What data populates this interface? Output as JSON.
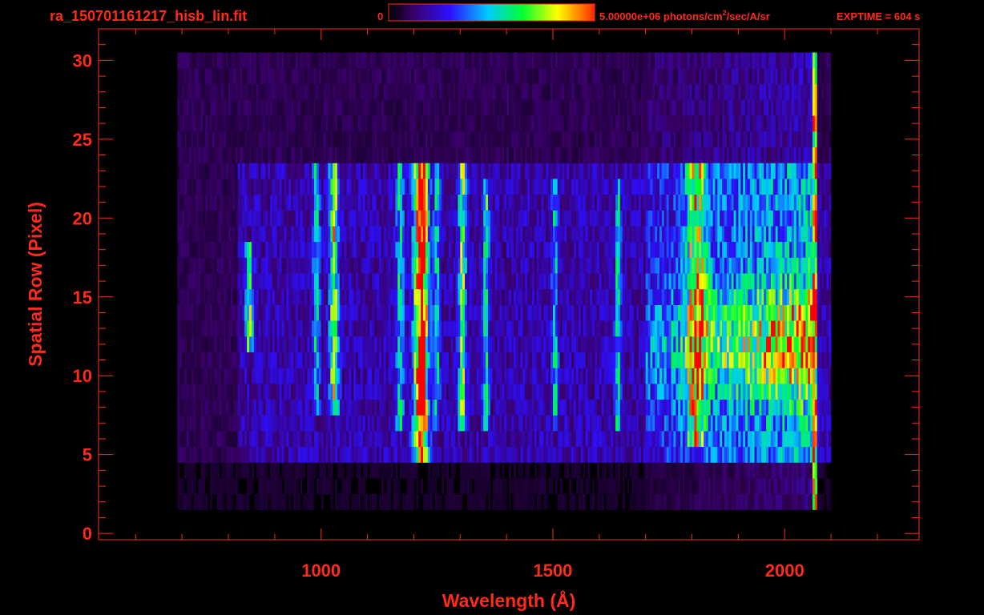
{
  "header": {
    "filename": "ra_150701161217_hisb_lin.fit",
    "colorbar_min_label": "0",
    "colorbar_max_label_pre": "5.00000e+06 photons/cm",
    "colorbar_max_label_sup": "2",
    "colorbar_max_label_post": "/sec/A/sr",
    "exptime_label": "EXPTIME = 604 s"
  },
  "colors": {
    "annotation": "#ff2a1a",
    "background": "#000000",
    "colormap": [
      "#000000",
      "#3a006a",
      "#2c10ff",
      "#00c8ff",
      "#00ff30",
      "#ffff00",
      "#ff0000"
    ]
  },
  "chart_data": {
    "type": "heatmap",
    "title": "ra_150701161217_hisb_lin.fit",
    "xlabel": "Wavelength (Å)",
    "ylabel": "Spatial Row (Pixel)",
    "xlim": [
      520,
      2290
    ],
    "ylim": [
      -0.4,
      32
    ],
    "x_ticks": [
      1000,
      1500,
      2000
    ],
    "y_ticks": [
      0,
      5,
      10,
      15,
      20,
      25,
      30
    ],
    "zlim": [
      0,
      5000000
    ],
    "zunit": "photons/cm^2/sec/A/sr",
    "exptime_s": 604,
    "grid": false,
    "rows": {
      "signal_band_rows": [
        5,
        23
      ],
      "upper_noise_rows": [
        24,
        30
      ],
      "lower_noise_rows": [
        2,
        4
      ]
    },
    "features": [
      {
        "name": "emission",
        "center": 1216,
        "width": 14,
        "level": 0.95,
        "rows": [
          5,
          23
        ]
      },
      {
        "name": "emission",
        "center": 1028,
        "width": 9,
        "level": 0.5,
        "rows": [
          8,
          23
        ]
      },
      {
        "name": "emission",
        "center": 1305,
        "width": 8,
        "level": 0.45,
        "rows": [
          7,
          23
        ]
      },
      {
        "name": "emission",
        "center": 1170,
        "width": 8,
        "level": 0.3,
        "rows": [
          7,
          23
        ]
      },
      {
        "name": "emission",
        "center": 1356,
        "width": 6,
        "level": 0.35,
        "rows": [
          7,
          22
        ]
      },
      {
        "name": "emission",
        "center": 990,
        "width": 7,
        "level": 0.3,
        "rows": [
          8,
          23
        ]
      },
      {
        "name": "emission",
        "center": 1250,
        "width": 6,
        "level": 0.3,
        "rows": [
          7,
          23
        ]
      },
      {
        "name": "emission",
        "center": 1505,
        "width": 6,
        "level": 0.3,
        "rows": [
          7,
          22
        ]
      },
      {
        "name": "emission",
        "center": 1640,
        "width": 6,
        "level": 0.3,
        "rows": [
          7,
          22
        ]
      },
      {
        "name": "emission",
        "center": 1810,
        "width": 20,
        "level": 0.45,
        "rows": [
          6,
          23
        ]
      },
      {
        "name": "emission",
        "center": 845,
        "width": 8,
        "level": 0.45,
        "rows": [
          12,
          18
        ]
      }
    ],
    "continuum": {
      "start": 1700,
      "end": 2065,
      "peak_rows": [
        10,
        14
      ],
      "level": 0.7
    },
    "detector_edge": {
      "wavelength": 2065,
      "level": 1.0
    }
  }
}
